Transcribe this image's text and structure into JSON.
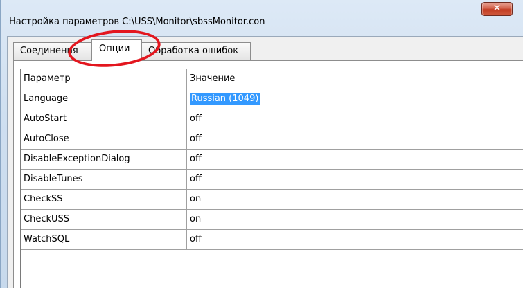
{
  "window": {
    "title": "Настройка параметров C:\\USS\\Monitor\\sbssMonitor.con",
    "close_glyph": "✕"
  },
  "tabs": [
    {
      "label": "Соединения",
      "active": false
    },
    {
      "label": "Опции",
      "active": true
    },
    {
      "label": "Обработка ошибок",
      "active": false
    }
  ],
  "grid": {
    "headers": [
      "Параметр",
      "Значение"
    ],
    "rows": [
      {
        "param": "Language",
        "value": "Russian (1049)"
      },
      {
        "param": "AutoStart",
        "value": "off"
      },
      {
        "param": "AutoClose",
        "value": "off"
      },
      {
        "param": "DisableExceptionDialog",
        "value": "off"
      },
      {
        "param": "DisableTunes",
        "value": "off"
      },
      {
        "param": "CheckSS",
        "value": "on"
      },
      {
        "param": "CheckUSS",
        "value": "on"
      },
      {
        "param": "WatchSQL",
        "value": "off"
      }
    ],
    "dropdown_glyph": "▼"
  },
  "colors": {
    "selection": "#3399ff",
    "annotation": "#e3161e",
    "close_button": "#c23c22"
  }
}
